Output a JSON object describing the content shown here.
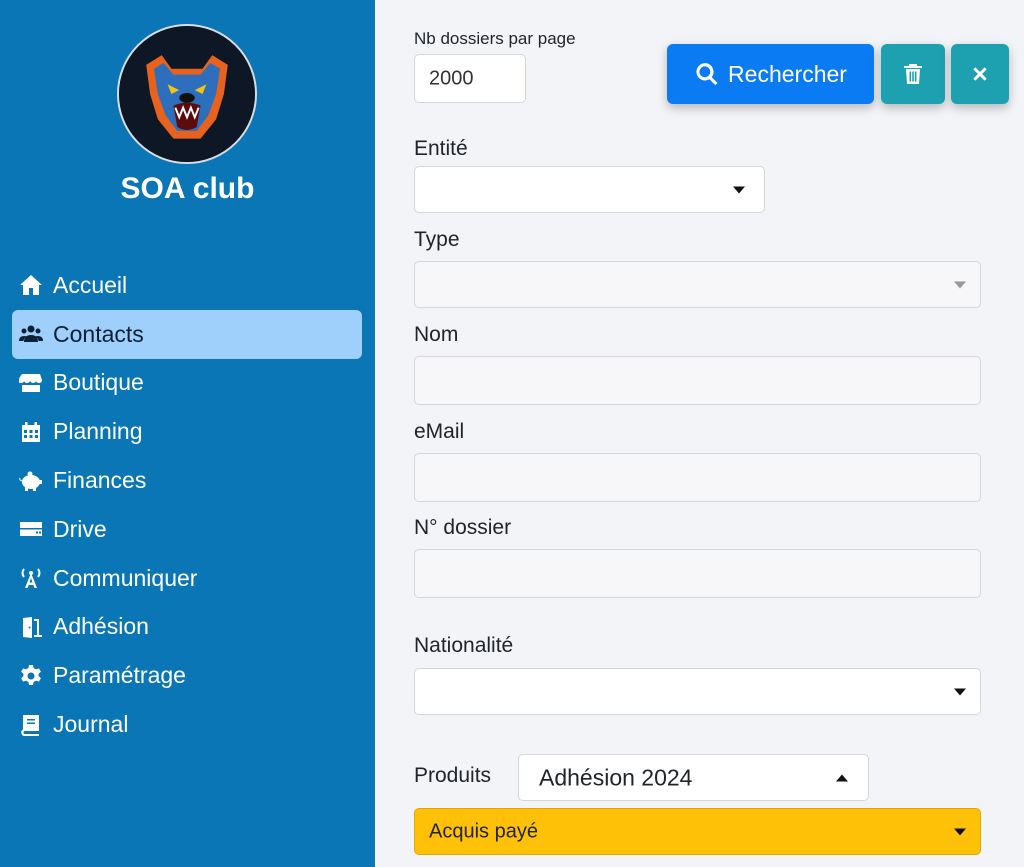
{
  "sidebar": {
    "club_name": "SOA club",
    "logo_icon": "bear-logo-icon",
    "items": [
      {
        "label": "Accueil",
        "icon": "home-icon",
        "active": false
      },
      {
        "label": "Contacts",
        "icon": "users-icon",
        "active": true
      },
      {
        "label": "Boutique",
        "icon": "store-icon",
        "active": false
      },
      {
        "label": "Planning",
        "icon": "calendar-icon",
        "active": false
      },
      {
        "label": "Finances",
        "icon": "piggy-bank-icon",
        "active": false
      },
      {
        "label": "Drive",
        "icon": "drive-icon",
        "active": false
      },
      {
        "label": "Communiquer",
        "icon": "broadcast-tower-icon",
        "active": false
      },
      {
        "label": "Adhésion",
        "icon": "door-open-icon",
        "active": false
      },
      {
        "label": "Paramétrage",
        "icon": "gear-icon",
        "active": false
      },
      {
        "label": "Journal",
        "icon": "book-icon",
        "active": false
      }
    ]
  },
  "form": {
    "per_page_label": "Nb dossiers par page",
    "per_page_value": "2000",
    "entity_label": "Entité",
    "entity_value": "",
    "type_label": "Type",
    "type_value": "",
    "nom_label": "Nom",
    "nom_value": "",
    "email_label": "eMail",
    "email_value": "",
    "dossier_label": "N° dossier",
    "dossier_value": "",
    "nationalite_label": "Nationalité",
    "nationalite_value": "",
    "produits_label": "Produits",
    "produits_value": "Adhésion 2024",
    "statut_value": "Acquis payé"
  },
  "toolbar": {
    "search_label": "Rechercher"
  },
  "colors": {
    "sidebar_bg": "#0a76b6",
    "active_item_bg": "#9fcffb",
    "search_button": "#0a7bf2",
    "secondary_button": "#1da1b0",
    "status_yellow": "#ffc107"
  }
}
